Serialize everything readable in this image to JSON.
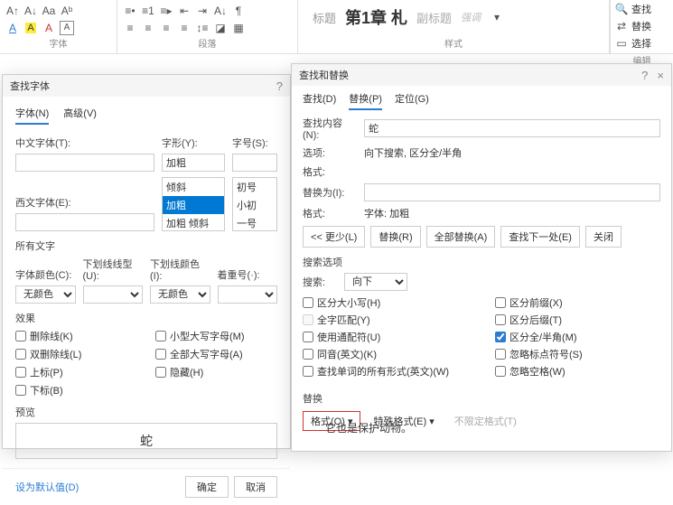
{
  "ribbon": {
    "font_label": "字体",
    "para_label": "段落",
    "styles_label": "样式",
    "edit_label": "编辑",
    "styles": {
      "title": "标题",
      "chapter": "第1章 札",
      "subtitle": "副标题",
      "emphasis": "强调"
    },
    "edit": {
      "find": "查找",
      "replace": "替换",
      "select": "选择"
    }
  },
  "font_dlg": {
    "title": "查找字体",
    "help": "?",
    "tab_font": "字体(N)",
    "tab_adv": "高级(V)",
    "cn_font": "中文字体(T):",
    "style": "字形(Y):",
    "size": "字号(S):",
    "west_font": "西文字体(E):",
    "style_opts": {
      "a": "加粗",
      "b": "倾斜",
      "c": "加粗",
      "d": "加粗 倾斜"
    },
    "size_opts": {
      "a": "初号",
      "b": "小初",
      "c": "一号"
    },
    "all_text": "所有文字",
    "color": "字体颜色(C):",
    "ul_style": "下划线线型(U):",
    "ul_color": "下划线颜色(I):",
    "emphasis": "着重号(·):",
    "nocolor": "无颜色",
    "effects": "效果",
    "strike": "删除线(K)",
    "dstrike": "双删除线(L)",
    "sup": "上标(P)",
    "sub": "下标(B)",
    "smallcap": "小型大写字母(M)",
    "allcap": "全部大写字母(A)",
    "hidden": "隐藏(H)",
    "preview": "预览",
    "preview_text": "蛇",
    "default": "设为默认值(D)",
    "ok": "确定",
    "cancel": "取消"
  },
  "fr_dlg": {
    "title": "查找和替换",
    "help": "?",
    "close": "×",
    "tab_find": "查找(D)",
    "tab_replace": "替换(P)",
    "tab_goto": "定位(G)",
    "find_what": "查找内容(N):",
    "find_val": "蛇",
    "options": "选项:",
    "options_val": "向下搜索, 区分全/半角",
    "format": "格式:",
    "replace_with": "替换为(I):",
    "replace_val": "",
    "format_val": "字体: 加粗",
    "less": "<< 更少(L)",
    "replace": "替换(R)",
    "replace_all": "全部替换(A)",
    "find_next": "查找下一处(E)",
    "close_btn": "关闭",
    "search_opts": "搜索选项",
    "search": "搜索:",
    "direction": "向下",
    "match_case": "区分大小写(H)",
    "whole_word": "全字匹配(Y)",
    "wildcards": "使用通配符(U)",
    "sounds": "同音(英文)(K)",
    "forms": "查找单词的所有形式(英文)(W)",
    "prefix": "区分前缀(X)",
    "suffix": "区分后缀(T)",
    "fullhalf": "区分全/半角(M)",
    "ignore_punct": "忽略标点符号(S)",
    "ignore_space": "忽略空格(W)",
    "replace_sect": "替换",
    "format_btn": "格式(O)",
    "special": "特殊格式(E)",
    "no_format": "不限定格式(T)"
  },
  "doc_text": "它也是保护动物。"
}
